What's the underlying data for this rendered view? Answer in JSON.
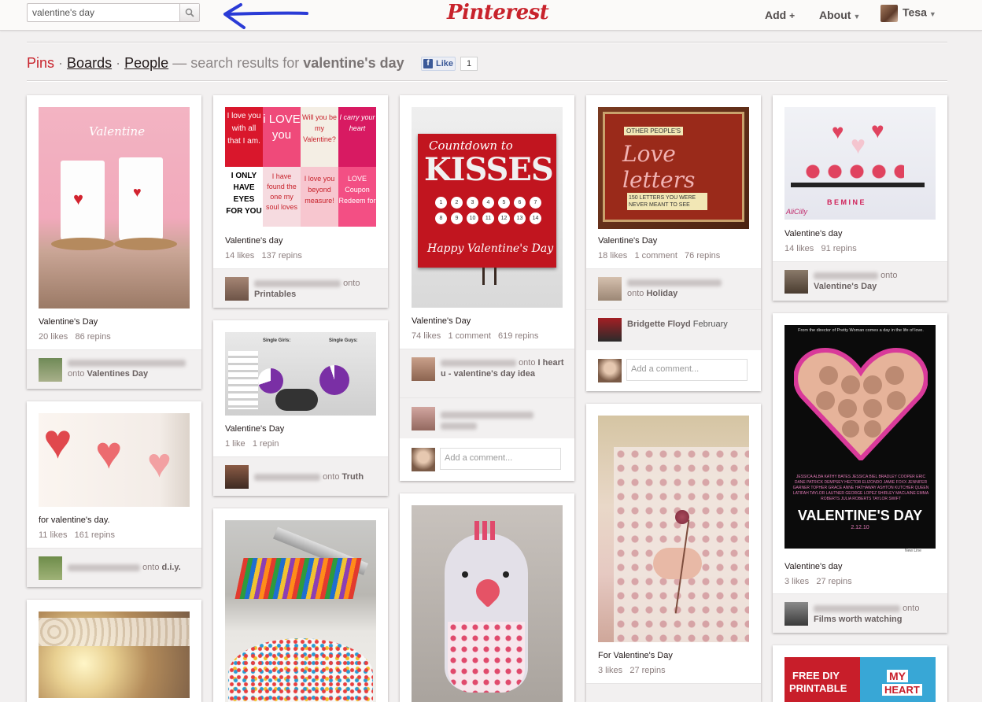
{
  "header": {
    "search_value": "valentine's day",
    "logo": "Pinterest",
    "nav_add": "Add",
    "nav_about": "About",
    "nav_user": "Tesa",
    "plus_glyph": "+"
  },
  "subheader": {
    "pins": "Pins",
    "boards": "Boards",
    "people": "People",
    "dot": "·",
    "prefix": "— search results for",
    "query": "valentine's day",
    "fb_like": "Like",
    "fb_count": "1"
  },
  "pins": {
    "p1": {
      "desc": "Valentine's Day",
      "stats": "20 likes   86 repins",
      "onto": "onto",
      "board": "Valentines Day",
      "img_text": "Valentine"
    },
    "p2": {
      "desc": "for valentine's day.",
      "stats": "11 likes   161 repins",
      "onto": "onto",
      "board": "d.i.y."
    },
    "p4": {
      "desc": "Valentine's day",
      "stats": "14 likes   137 repins",
      "onto": "onto",
      "board": "Printables",
      "tiles": [
        "I love you with all that I am.",
        "i LOVE you",
        "Will you be my Valentine?",
        "I carry your heart",
        "I ONLY HAVE EYES FOR YOU",
        "I have found the one my soul loves",
        "I love you beyond measure!",
        "LOVE Coupon Redeem for"
      ]
    },
    "p5": {
      "desc": "Valentine's Day",
      "stats": "1 like   1 repin",
      "board": "Truth",
      "onto": "onto",
      "label_girls": "Single Girls:",
      "label_guys": "Single Guys:"
    },
    "p7": {
      "desc": "Valentine's Day",
      "stats": "74 likes   1 comment   619 repins",
      "onto": "onto",
      "board": "I heart u - valentine's day idea",
      "sign_top": "Countdown to",
      "sign_big": "KISSES",
      "sign_bottom": "Happy Valentine's Day",
      "numbers": [
        "1",
        "2",
        "3",
        "4",
        "5",
        "6",
        "7",
        "8",
        "9",
        "10",
        "11",
        "12",
        "13",
        "14"
      ],
      "comment_placeholder": "Add a comment..."
    },
    "p9": {
      "desc": "Valentine's Day",
      "stats": "18 likes   1 comment   76 repins",
      "onto": "onto",
      "board": "Holiday",
      "commenter": "Bridgette Floyd",
      "comment_text": "February",
      "comment_placeholder": "Add a comment...",
      "book_small": "OTHER PEOPLE'S",
      "book_title": "Love letters",
      "book_sub": "150 LETTERS YOU WERE NEVER MEANT TO SEE"
    },
    "p10": {
      "desc": "For Valentine's Day",
      "stats": "3 likes   27 repins"
    },
    "p11": {
      "desc": "Valentine's day",
      "stats": "14 likes   91 repins",
      "onto": "onto",
      "board": "Valentine's Day",
      "img_text": "AliCilly",
      "banner": "B E M I N E"
    },
    "p12": {
      "desc": "Valentine's day",
      "stats": "3 likes   27 repins",
      "onto": "onto",
      "board": "Films worth watching",
      "tagline": "From the director of Pretty Woman comes a day in the life of love.",
      "poster_title": "VALENTINE'S DAY",
      "poster_date": "2.12.10",
      "cast": "JESSICA ALBA  KATHY BATES  JESSICA BIEL  BRADLEY COOPER  ERIC DANE  PATRICK DEMPSEY  HECTOR ELIZONDO  JAMIE FOXX  JENNIFER GARNER  TOPHER GRACE  ANNE HATHAWAY  ASHTON KUTCHER  QUEEN LATIFAH  TAYLOR LAUTNER  GEORGE LOPEZ  SHIRLEY MACLAINE  EMMA ROBERTS  JULIA ROBERTS  TAYLOR SWIFT",
      "studio": "New Line"
    },
    "p13": {
      "line1": "FREE DIY",
      "line2": "PRINTABLE",
      "line3": "MY",
      "line4": "HEART"
    }
  },
  "colors": {
    "brand": "#c8232c",
    "background": "#f2f0f0",
    "annotation_arrow": "#2a3bd6"
  }
}
